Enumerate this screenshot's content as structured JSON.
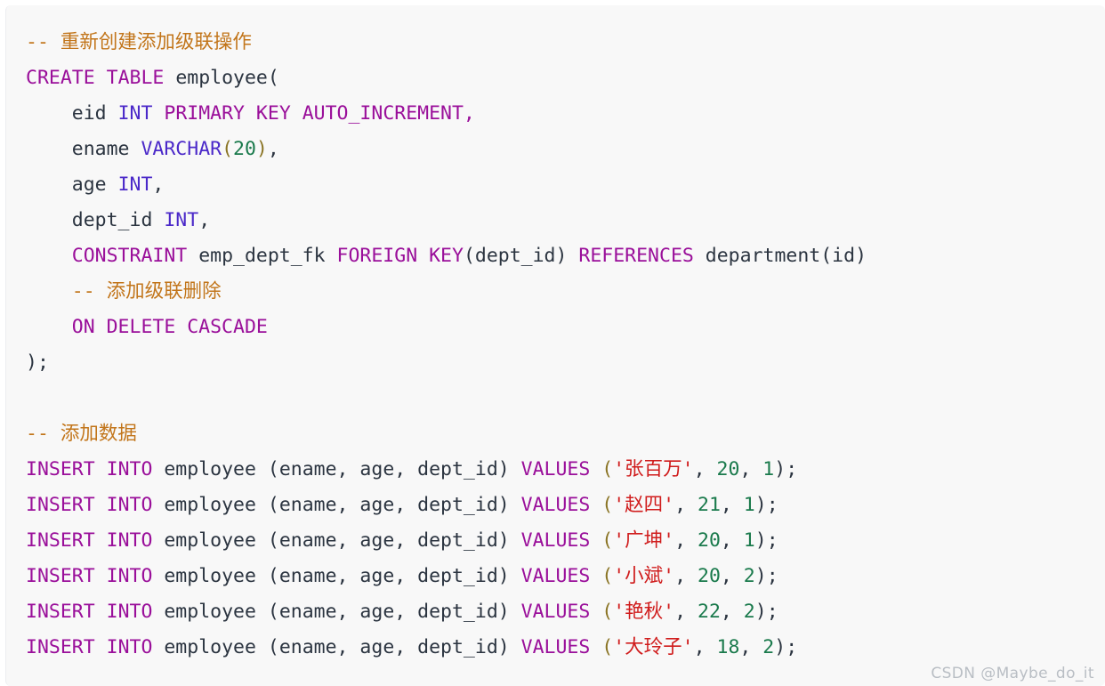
{
  "code_block": {
    "language": "sql",
    "background": "#f8f8f8",
    "colors": {
      "comment": "#c2751a",
      "keyword": "#9a0f9a",
      "type": "#4b29c9",
      "identifier": "#2b3440",
      "number": "#1a7a4c",
      "string": "#d01c1c",
      "punctuation": "#8a7424"
    },
    "lines": [
      {
        "n": 1,
        "text": "-- 重新创建添加级联操作"
      },
      {
        "n": 2,
        "text": "CREATE TABLE employee("
      },
      {
        "n": 3,
        "text": "    eid INT PRIMARY KEY AUTO_INCREMENT,"
      },
      {
        "n": 4,
        "text": "    ename VARCHAR(20),"
      },
      {
        "n": 5,
        "text": "    age INT,"
      },
      {
        "n": 6,
        "text": "    dept_id INT,"
      },
      {
        "n": 7,
        "text": "    CONSTRAINT emp_dept_fk FOREIGN KEY(dept_id) REFERENCES department(id)"
      },
      {
        "n": 8,
        "text": "    -- 添加级联删除"
      },
      {
        "n": 9,
        "text": "    ON DELETE CASCADE"
      },
      {
        "n": 10,
        "text": ");"
      },
      {
        "n": 11,
        "text": ""
      },
      {
        "n": 12,
        "text": "-- 添加数据"
      },
      {
        "n": 13,
        "text": "INSERT INTO employee (ename, age, dept_id) VALUES ('张百万', 20, 1);"
      },
      {
        "n": 14,
        "text": "INSERT INTO employee (ename, age, dept_id) VALUES ('赵四', 21, 1);"
      },
      {
        "n": 15,
        "text": "INSERT INTO employee (ename, age, dept_id) VALUES ('广坤', 20, 1);"
      },
      {
        "n": 16,
        "text": "INSERT INTO employee (ename, age, dept_id) VALUES ('小斌', 20, 2);"
      },
      {
        "n": 17,
        "text": "INSERT INTO employee (ename, age, dept_id) VALUES ('艳秋', 22, 2);"
      },
      {
        "n": 18,
        "text": "INSERT INTO employee (ename, age, dept_id) VALUES ('大玲子', 18, 2);"
      }
    ],
    "tokens": {
      "l1_comment": "-- 重新创建添加级联操作",
      "l2_kw_create": "CREATE",
      "l2_kw_table": "TABLE",
      "l2_tbl": "employee(",
      "l3_col": "eid",
      "l3_ty": "INT",
      "l3_kw": "PRIMARY KEY AUTO_INCREMENT,",
      "l4_col": "ename",
      "l4_ty": "VARCHAR",
      "l4_open": "(",
      "l4_num": "20",
      "l4_close": ")",
      "l4_comma": ",",
      "l5_col": "age",
      "l5_ty": "INT",
      "l5_comma": ",",
      "l6_col": "dept_id",
      "l6_ty": "INT",
      "l6_comma": ",",
      "l7_kw_constraint": "CONSTRAINT",
      "l7_name": "emp_dept_fk",
      "l7_kw_foreign": "FOREIGN",
      "l7_kw_key": "KEY",
      "l7_keycols": "(dept_id)",
      "l7_kw_references": "REFERENCES",
      "l7_ref": "department(id)",
      "l8_comment": "-- 添加级联删除",
      "l9_kw": "ON DELETE CASCADE",
      "l10_close": ");",
      "l12_comment": "-- 添加数据",
      "ins_kw_insert": "INSERT",
      "ins_kw_into": "INTO",
      "ins_table": "employee",
      "ins_cols": "(ename, age, dept_id)",
      "ins_kw_values": "VALUES",
      "ins_open": "(",
      "ins_close": ");"
    },
    "rows": [
      {
        "name": "'张百万'",
        "age": "20",
        "dept_id": "1"
      },
      {
        "name": "'赵四'",
        "age": "21",
        "dept_id": "1"
      },
      {
        "name": "'广坤'",
        "age": "20",
        "dept_id": "1"
      },
      {
        "name": "'小斌'",
        "age": "20",
        "dept_id": "2"
      },
      {
        "name": "'艳秋'",
        "age": "22",
        "dept_id": "2"
      },
      {
        "name": "'大玲子'",
        "age": "18",
        "dept_id": "2"
      }
    ]
  },
  "watermark": {
    "text": "CSDN @Maybe_do_it"
  }
}
